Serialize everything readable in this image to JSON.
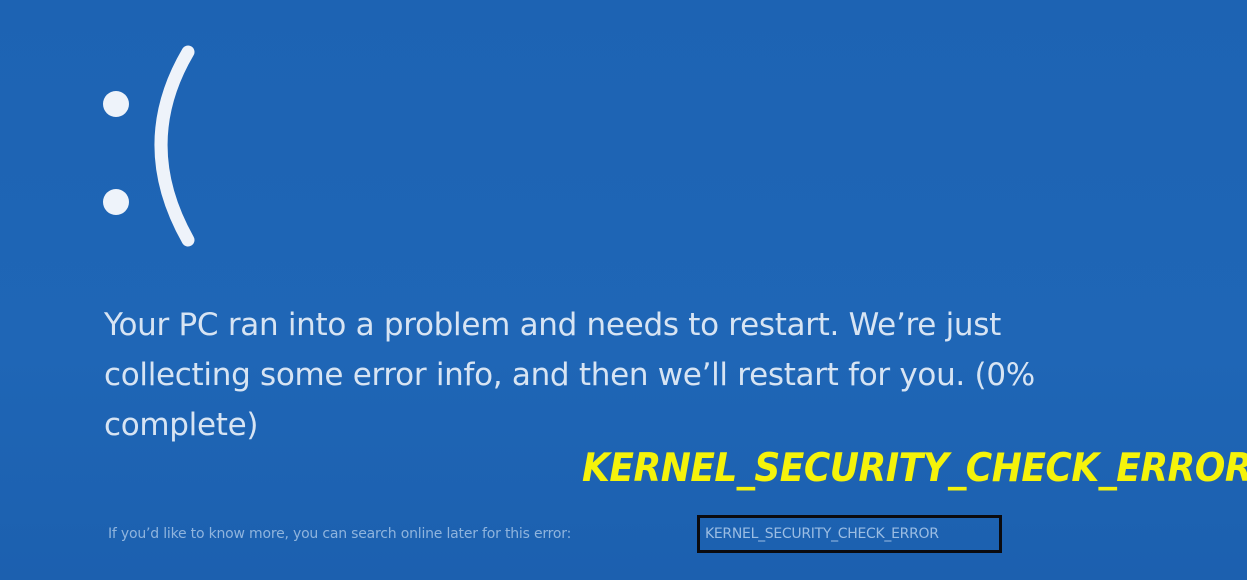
{
  "screen": {
    "background_color": "#1e64b4",
    "text_color": "#d7e4f3",
    "callout_color": "#f5f30a",
    "frown_icon": "sad-face-icon"
  },
  "message": "Your PC ran into a problem and needs to restart. We’re just collecting some error info, and then we’ll restart for you. (0% complete)",
  "progress_percent": 0,
  "callout_label": "KERNEL_SECURITY_CHECK_ERROR",
  "more_info": {
    "lead_text": "If you’d like to know more, you can search online later for this error:",
    "stop_code": "KERNEL_SECURITY_CHECK_ERROR"
  }
}
